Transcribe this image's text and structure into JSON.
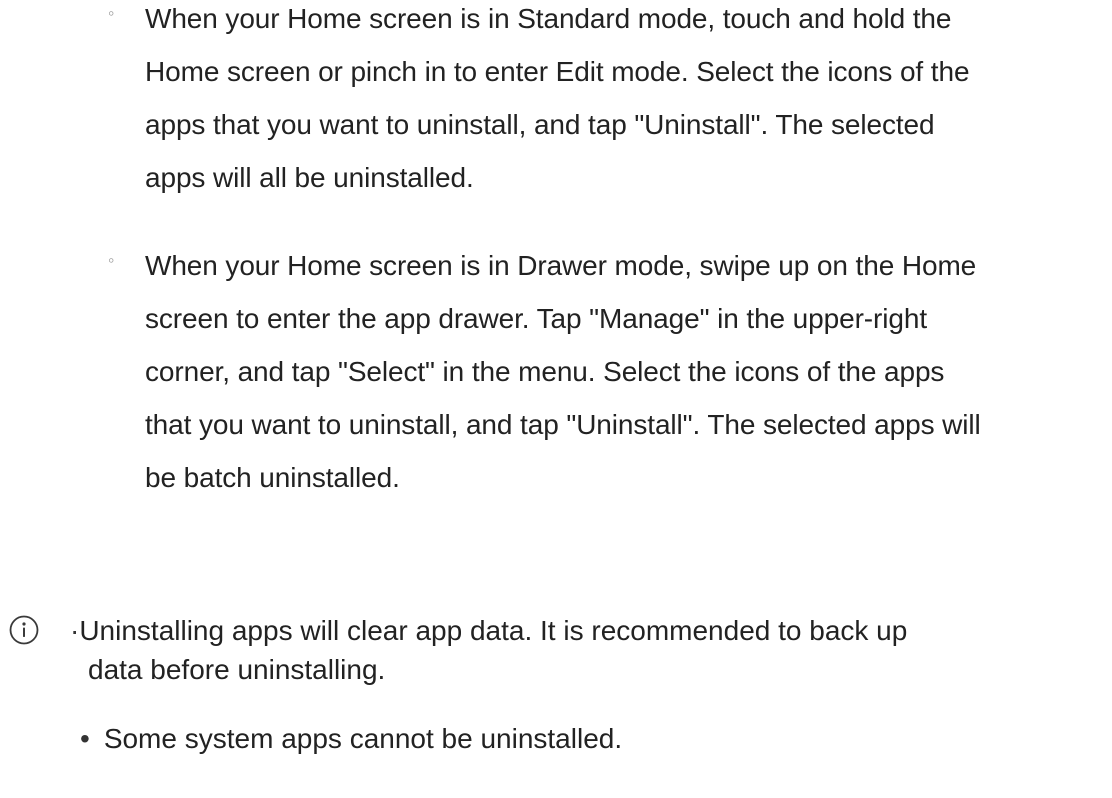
{
  "sub_items": [
    {
      "marker": "◦",
      "lines": [
        "When your Home screen is in Standard mode, touch and hold the",
        "Home screen or pinch in to enter Edit mode. Select the icons of the",
        "apps that you want to uninstall, and tap \"Uninstall\". The selected",
        "apps will all be uninstalled."
      ]
    },
    {
      "marker": "◦",
      "lines": [
        "When your Home screen is in Drawer mode, swipe up on the Home",
        "screen to enter the app drawer. Tap \"Manage\" in the upper-right",
        "corner, and tap \"Select\" in the menu. Select the icons of the apps",
        "that you want to uninstall, and tap \"Uninstall\". The selected apps will",
        "be batch uninstalled."
      ]
    }
  ],
  "note": {
    "icon": "info-icon",
    "bullet_one_prefix": "·",
    "bullet_one_line1": "Uninstalling apps will clear app data. It is recommended to back up",
    "bullet_one_line2": "data before uninstalling.",
    "bullet_two_prefix": "•",
    "bullet_two_text": "Some system apps cannot be uninstalled."
  }
}
